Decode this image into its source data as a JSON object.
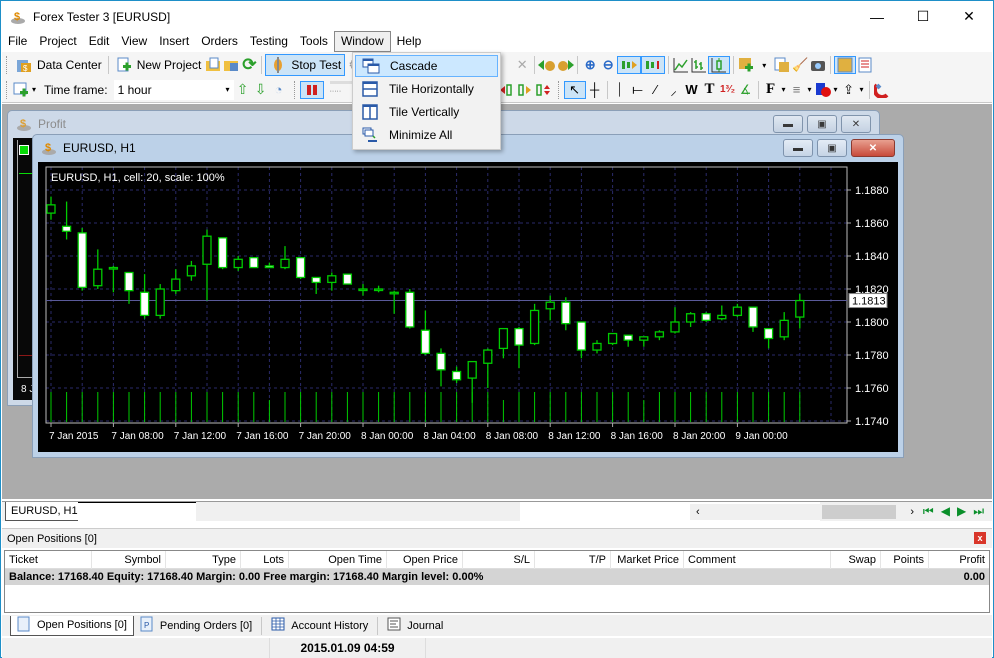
{
  "app": {
    "title": "Forex Tester 3  [EURUSD]",
    "window_controls": {
      "minimize": "—",
      "maximize": "☐",
      "close": "✕"
    }
  },
  "menubar": {
    "items": [
      "File",
      "Project",
      "Edit",
      "View",
      "Insert",
      "Orders",
      "Testing",
      "Tools",
      "Window",
      "Help"
    ],
    "active": "Window"
  },
  "toolbar1": {
    "data_center": "Data Center",
    "new_project": "New Project",
    "stop_test": "Stop Test"
  },
  "toolbar2": {
    "timeframe_label": "Time frame:",
    "timeframe_value": "1 hour"
  },
  "window_menu": {
    "items": [
      {
        "label": "Cascade",
        "icon": "cascade-icon",
        "highlighted": true
      },
      {
        "label": "Tile Horizontally",
        "icon": "tile-horizontal-icon",
        "highlighted": false
      },
      {
        "label": "Tile Vertically",
        "icon": "tile-vertical-icon",
        "highlighted": false
      },
      {
        "label": "Minimize All",
        "icon": "minimize-all-icon",
        "highlighted": false
      }
    ]
  },
  "profit_window": {
    "title": "Profit",
    "x_label_partial": "8 J"
  },
  "chart_window": {
    "title": "EURUSD, H1",
    "info": "EURUSD, H1, cell: 20, scale: 100%",
    "current_price_label": "1.1813"
  },
  "chart_data": {
    "type": "candlestick",
    "title": "EURUSD, H1, cell: 20, scale: 100%",
    "xlabel": "",
    "ylabel": "",
    "ylim": [
      1.1735,
      1.1885
    ],
    "yticks": [
      "1.1880",
      "1.1860",
      "1.1840",
      "1.1820",
      "1.1800",
      "1.1780",
      "1.1760",
      "1.1740"
    ],
    "ytick_values": [
      1.188,
      1.186,
      1.184,
      1.182,
      1.18,
      1.178,
      1.176,
      1.174
    ],
    "xtick_labels": [
      "7 Jan 2015",
      "7 Jan 08:00",
      "7 Jan 12:00",
      "7 Jan 16:00",
      "7 Jan 20:00",
      "8 Jan 00:00",
      "8 Jan 04:00",
      "8 Jan 08:00",
      "8 Jan 12:00",
      "8 Jan 16:00",
      "8 Jan 20:00",
      "9 Jan 00:00"
    ],
    "xtick_bar_index": [
      0,
      4,
      8,
      12,
      16,
      20,
      24,
      28,
      32,
      36,
      40,
      44
    ],
    "current_price": 1.1813,
    "grid": true,
    "candles": [
      {
        "o": 1.1866,
        "h": 1.1876,
        "l": 1.1862,
        "c": 1.1871
      },
      {
        "o": 1.1858,
        "h": 1.1873,
        "l": 1.185,
        "c": 1.1855
      },
      {
        "o": 1.1854,
        "h": 1.1857,
        "l": 1.1819,
        "c": 1.1821
      },
      {
        "o": 1.1822,
        "h": 1.1844,
        "l": 1.182,
        "c": 1.1832
      },
      {
        "o": 1.1833,
        "h": 1.1834,
        "l": 1.1818,
        "c": 1.1833
      },
      {
        "o": 1.183,
        "h": 1.183,
        "l": 1.1811,
        "c": 1.1819
      },
      {
        "o": 1.1818,
        "h": 1.1829,
        "l": 1.1802,
        "c": 1.1804
      },
      {
        "o": 1.1804,
        "h": 1.1823,
        "l": 1.1802,
        "c": 1.182
      },
      {
        "o": 1.1819,
        "h": 1.1832,
        "l": 1.1817,
        "c": 1.1826
      },
      {
        "o": 1.1828,
        "h": 1.1837,
        "l": 1.1825,
        "c": 1.1834
      },
      {
        "o": 1.1835,
        "h": 1.1856,
        "l": 1.1813,
        "c": 1.1852
      },
      {
        "o": 1.1851,
        "h": 1.1851,
        "l": 1.1832,
        "c": 1.1833
      },
      {
        "o": 1.1833,
        "h": 1.184,
        "l": 1.1831,
        "c": 1.1838
      },
      {
        "o": 1.1839,
        "h": 1.1839,
        "l": 1.1833,
        "c": 1.1833
      },
      {
        "o": 1.1834,
        "h": 1.1836,
        "l": 1.1834,
        "c": 1.1833
      },
      {
        "o": 1.1833,
        "h": 1.1846,
        "l": 1.1832,
        "c": 1.1838
      },
      {
        "o": 1.1839,
        "h": 1.1837,
        "l": 1.1826,
        "c": 1.1827
      },
      {
        "o": 1.1827,
        "h": 1.1827,
        "l": 1.1817,
        "c": 1.1824
      },
      {
        "o": 1.1824,
        "h": 1.183,
        "l": 1.1819,
        "c": 1.1828
      },
      {
        "o": 1.1829,
        "h": 1.1829,
        "l": 1.1823,
        "c": 1.1823
      },
      {
        "o": 1.182,
        "h": 1.1823,
        "l": 1.1816,
        "c": 1.182
      },
      {
        "o": 1.182,
        "h": 1.1822,
        "l": 1.1818,
        "c": 1.182
      },
      {
        "o": 1.1818,
        "h": 1.1819,
        "l": 1.1805,
        "c": 1.1818
      },
      {
        "o": 1.1818,
        "h": 1.182,
        "l": 1.1796,
        "c": 1.1797
      },
      {
        "o": 1.1795,
        "h": 1.1807,
        "l": 1.178,
        "c": 1.1781
      },
      {
        "o": 1.1781,
        "h": 1.1784,
        "l": 1.1761,
        "c": 1.1771
      },
      {
        "o": 1.177,
        "h": 1.1773,
        "l": 1.1763,
        "c": 1.1765
      },
      {
        "o": 1.1766,
        "h": 1.1776,
        "l": 1.1751,
        "c": 1.1776
      },
      {
        "o": 1.1775,
        "h": 1.1784,
        "l": 1.176,
        "c": 1.1783
      },
      {
        "o": 1.1784,
        "h": 1.1796,
        "l": 1.1778,
        "c": 1.1796
      },
      {
        "o": 1.1796,
        "h": 1.1797,
        "l": 1.1772,
        "c": 1.1786
      },
      {
        "o": 1.1787,
        "h": 1.1811,
        "l": 1.1786,
        "c": 1.1807
      },
      {
        "o": 1.1808,
        "h": 1.1816,
        "l": 1.1801,
        "c": 1.1812
      },
      {
        "o": 1.1812,
        "h": 1.1815,
        "l": 1.1795,
        "c": 1.1799
      },
      {
        "o": 1.18,
        "h": 1.18,
        "l": 1.1778,
        "c": 1.1783
      },
      {
        "o": 1.1783,
        "h": 1.1789,
        "l": 1.1781,
        "c": 1.1787
      },
      {
        "o": 1.1787,
        "h": 1.1793,
        "l": 1.1786,
        "c": 1.1793
      },
      {
        "o": 1.1792,
        "h": 1.1792,
        "l": 1.1785,
        "c": 1.1789
      },
      {
        "o": 1.1789,
        "h": 1.179,
        "l": 1.1785,
        "c": 1.1791
      },
      {
        "o": 1.1791,
        "h": 1.1795,
        "l": 1.1789,
        "c": 1.1794
      },
      {
        "o": 1.1794,
        "h": 1.1809,
        "l": 1.1793,
        "c": 1.18
      },
      {
        "o": 1.18,
        "h": 1.1806,
        "l": 1.1797,
        "c": 1.1805
      },
      {
        "o": 1.1805,
        "h": 1.1806,
        "l": 1.18,
        "c": 1.1801
      },
      {
        "o": 1.1802,
        "h": 1.181,
        "l": 1.1801,
        "c": 1.1804
      },
      {
        "o": 1.1804,
        "h": 1.1811,
        "l": 1.1803,
        "c": 1.1809
      },
      {
        "o": 1.1809,
        "h": 1.1809,
        "l": 1.1794,
        "c": 1.1797
      },
      {
        "o": 1.1796,
        "h": 1.1796,
        "l": 1.1784,
        "c": 1.179
      },
      {
        "o": 1.1791,
        "h": 1.1806,
        "l": 1.1789,
        "c": 1.1801
      },
      {
        "o": 1.1803,
        "h": 1.1817,
        "l": 1.1796,
        "c": 1.1813
      }
    ]
  },
  "chart_tabs": {
    "items": [
      "EURUSD, H1",
      "Profit"
    ],
    "active": "EURUSD, H1"
  },
  "positions_panel": {
    "title": "Open Positions [0]",
    "close_icon": "x",
    "columns": [
      "Ticket",
      "Symbol",
      "Type",
      "Lots",
      "Open Time",
      "Open Price",
      "S/L",
      "T/P",
      "Market Price",
      "Comment",
      "Swap",
      "Points",
      "Profit"
    ],
    "summary": "Balance: 17168.40 Equity: 17168.40 Margin: 0.00 Free margin: 17168.40 Margin level: 0.00%",
    "summary_profit": "0.00",
    "tabs": [
      "Open Positions [0]",
      "Pending Orders [0]",
      "Account History",
      "Journal"
    ],
    "active_tab": "Open Positions [0]"
  },
  "statusbar": {
    "datetime": "2015.01.09 04:59"
  },
  "colors": {
    "bull": "#00cc00",
    "bear_body": "#ffffff",
    "grid": "#2a2a6a",
    "price_line": "#5a5a9a",
    "chart_bg": "#000000",
    "highlight": "#cce8ff"
  }
}
